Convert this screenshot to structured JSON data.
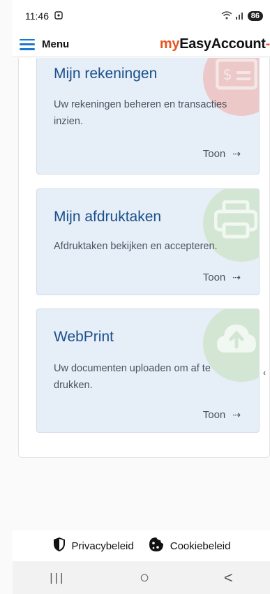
{
  "status": {
    "time": "11:46",
    "battery": "86"
  },
  "header": {
    "menu_label": "Menu",
    "brand_my": "my",
    "brand_rest": "EasyAccount",
    "brand_dash": "-"
  },
  "cards": [
    {
      "title": "Mijn rekeningen",
      "description": "Uw rekeningen beheren en transacties inzien.",
      "action": "Toon",
      "icon": "invoice-icon",
      "accent": "#e8c4c4"
    },
    {
      "title": "Mijn afdruktaken",
      "description": "Afdruktaken bekijken en accepteren.",
      "action": "Toon",
      "icon": "printer-icon",
      "accent": "#cfe3cf"
    },
    {
      "title": "WebPrint",
      "description": "Uw documenten uploaden om af te drukken.",
      "action": "Toon",
      "icon": "cloud-upload-icon",
      "accent": "#cfe3cf"
    }
  ],
  "edge_glyph": "‹",
  "footer": {
    "privacy": "Privacybeleid",
    "cookies": "Cookiebeleid"
  },
  "navbar": {
    "recents": "|||",
    "home": "○",
    "back": "<"
  }
}
